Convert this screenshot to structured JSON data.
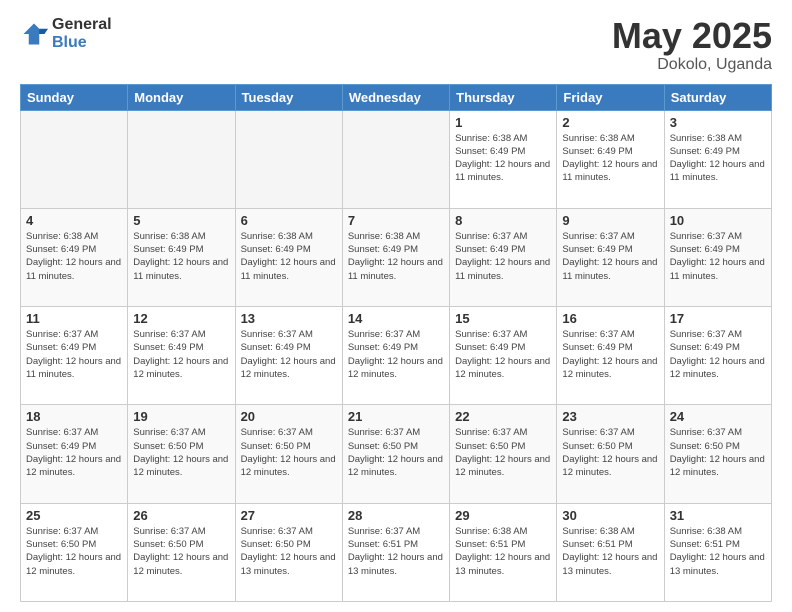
{
  "logo": {
    "general": "General",
    "blue": "Blue"
  },
  "title": {
    "month": "May 2025",
    "location": "Dokolo, Uganda"
  },
  "days_of_week": [
    "Sunday",
    "Monday",
    "Tuesday",
    "Wednesday",
    "Thursday",
    "Friday",
    "Saturday"
  ],
  "weeks": [
    [
      {
        "day": "",
        "info": ""
      },
      {
        "day": "",
        "info": ""
      },
      {
        "day": "",
        "info": ""
      },
      {
        "day": "",
        "info": ""
      },
      {
        "day": "1",
        "info": "Sunrise: 6:38 AM\nSunset: 6:49 PM\nDaylight: 12 hours\nand 11 minutes."
      },
      {
        "day": "2",
        "info": "Sunrise: 6:38 AM\nSunset: 6:49 PM\nDaylight: 12 hours\nand 11 minutes."
      },
      {
        "day": "3",
        "info": "Sunrise: 6:38 AM\nSunset: 6:49 PM\nDaylight: 12 hours\nand 11 minutes."
      }
    ],
    [
      {
        "day": "4",
        "info": "Sunrise: 6:38 AM\nSunset: 6:49 PM\nDaylight: 12 hours\nand 11 minutes."
      },
      {
        "day": "5",
        "info": "Sunrise: 6:38 AM\nSunset: 6:49 PM\nDaylight: 12 hours\nand 11 minutes."
      },
      {
        "day": "6",
        "info": "Sunrise: 6:38 AM\nSunset: 6:49 PM\nDaylight: 12 hours\nand 11 minutes."
      },
      {
        "day": "7",
        "info": "Sunrise: 6:38 AM\nSunset: 6:49 PM\nDaylight: 12 hours\nand 11 minutes."
      },
      {
        "day": "8",
        "info": "Sunrise: 6:37 AM\nSunset: 6:49 PM\nDaylight: 12 hours\nand 11 minutes."
      },
      {
        "day": "9",
        "info": "Sunrise: 6:37 AM\nSunset: 6:49 PM\nDaylight: 12 hours\nand 11 minutes."
      },
      {
        "day": "10",
        "info": "Sunrise: 6:37 AM\nSunset: 6:49 PM\nDaylight: 12 hours\nand 11 minutes."
      }
    ],
    [
      {
        "day": "11",
        "info": "Sunrise: 6:37 AM\nSunset: 6:49 PM\nDaylight: 12 hours\nand 11 minutes."
      },
      {
        "day": "12",
        "info": "Sunrise: 6:37 AM\nSunset: 6:49 PM\nDaylight: 12 hours\nand 12 minutes."
      },
      {
        "day": "13",
        "info": "Sunrise: 6:37 AM\nSunset: 6:49 PM\nDaylight: 12 hours\nand 12 minutes."
      },
      {
        "day": "14",
        "info": "Sunrise: 6:37 AM\nSunset: 6:49 PM\nDaylight: 12 hours\nand 12 minutes."
      },
      {
        "day": "15",
        "info": "Sunrise: 6:37 AM\nSunset: 6:49 PM\nDaylight: 12 hours\nand 12 minutes."
      },
      {
        "day": "16",
        "info": "Sunrise: 6:37 AM\nSunset: 6:49 PM\nDaylight: 12 hours\nand 12 minutes."
      },
      {
        "day": "17",
        "info": "Sunrise: 6:37 AM\nSunset: 6:49 PM\nDaylight: 12 hours\nand 12 minutes."
      }
    ],
    [
      {
        "day": "18",
        "info": "Sunrise: 6:37 AM\nSunset: 6:49 PM\nDaylight: 12 hours\nand 12 minutes."
      },
      {
        "day": "19",
        "info": "Sunrise: 6:37 AM\nSunset: 6:50 PM\nDaylight: 12 hours\nand 12 minutes."
      },
      {
        "day": "20",
        "info": "Sunrise: 6:37 AM\nSunset: 6:50 PM\nDaylight: 12 hours\nand 12 minutes."
      },
      {
        "day": "21",
        "info": "Sunrise: 6:37 AM\nSunset: 6:50 PM\nDaylight: 12 hours\nand 12 minutes."
      },
      {
        "day": "22",
        "info": "Sunrise: 6:37 AM\nSunset: 6:50 PM\nDaylight: 12 hours\nand 12 minutes."
      },
      {
        "day": "23",
        "info": "Sunrise: 6:37 AM\nSunset: 6:50 PM\nDaylight: 12 hours\nand 12 minutes."
      },
      {
        "day": "24",
        "info": "Sunrise: 6:37 AM\nSunset: 6:50 PM\nDaylight: 12 hours\nand 12 minutes."
      }
    ],
    [
      {
        "day": "25",
        "info": "Sunrise: 6:37 AM\nSunset: 6:50 PM\nDaylight: 12 hours\nand 12 minutes."
      },
      {
        "day": "26",
        "info": "Sunrise: 6:37 AM\nSunset: 6:50 PM\nDaylight: 12 hours\nand 12 minutes."
      },
      {
        "day": "27",
        "info": "Sunrise: 6:37 AM\nSunset: 6:50 PM\nDaylight: 12 hours\nand 13 minutes."
      },
      {
        "day": "28",
        "info": "Sunrise: 6:37 AM\nSunset: 6:51 PM\nDaylight: 12 hours\nand 13 minutes."
      },
      {
        "day": "29",
        "info": "Sunrise: 6:38 AM\nSunset: 6:51 PM\nDaylight: 12 hours\nand 13 minutes."
      },
      {
        "day": "30",
        "info": "Sunrise: 6:38 AM\nSunset: 6:51 PM\nDaylight: 12 hours\nand 13 minutes."
      },
      {
        "day": "31",
        "info": "Sunrise: 6:38 AM\nSunset: 6:51 PM\nDaylight: 12 hours\nand 13 minutes."
      }
    ]
  ]
}
